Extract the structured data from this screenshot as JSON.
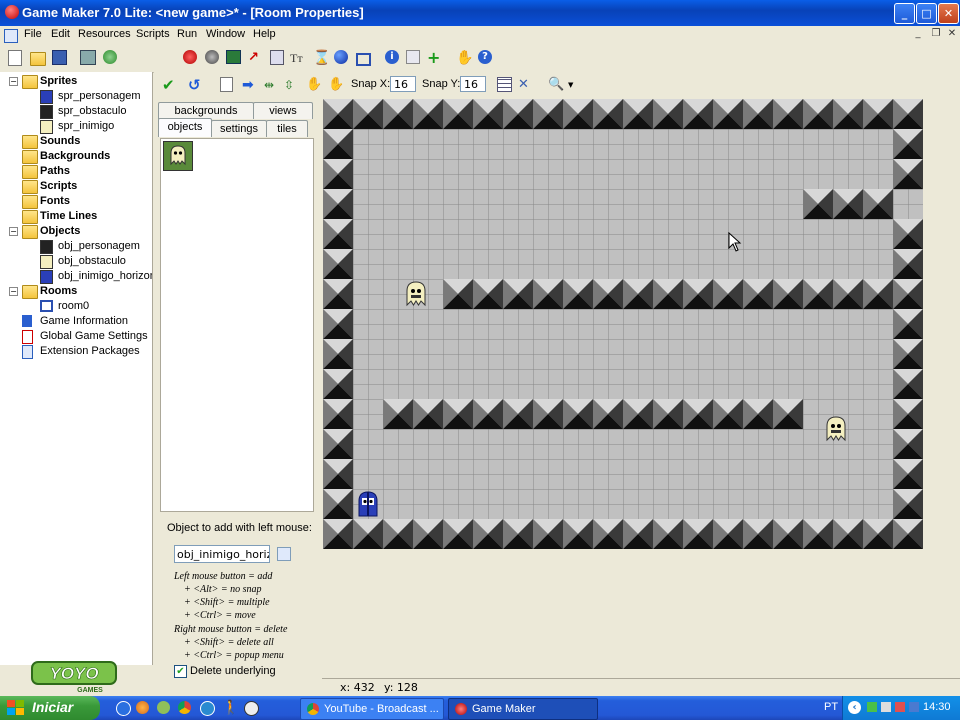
{
  "window": {
    "title": "Game Maker 7.0 Lite: <new game>* - [Room Properties]",
    "controls": [
      "minimize",
      "maximize",
      "close"
    ]
  },
  "menu": [
    "File",
    "Edit",
    "Resources",
    "Scripts",
    "Run",
    "Window",
    "Help"
  ],
  "tree": [
    {
      "label": "Sprites",
      "kind": "folder",
      "bold": true
    },
    {
      "label": "spr_personagem",
      "kind": "sprite",
      "bold": false
    },
    {
      "label": "spr_obstaculo",
      "kind": "sprite",
      "bold": false
    },
    {
      "label": "spr_inimigo",
      "kind": "sprite",
      "bold": false
    },
    {
      "label": "Sounds",
      "kind": "folder",
      "bold": true
    },
    {
      "label": "Backgrounds",
      "kind": "folder",
      "bold": true
    },
    {
      "label": "Paths",
      "kind": "folder",
      "bold": true
    },
    {
      "label": "Scripts",
      "kind": "folder",
      "bold": true
    },
    {
      "label": "Fonts",
      "kind": "folder",
      "bold": true
    },
    {
      "label": "Time Lines",
      "kind": "folder",
      "bold": true
    },
    {
      "label": "Objects",
      "kind": "folder",
      "bold": true
    },
    {
      "label": "obj_personagem",
      "kind": "object",
      "bold": false
    },
    {
      "label": "obj_obstaculo",
      "kind": "object",
      "bold": false
    },
    {
      "label": "obj_inimigo_horizont",
      "kind": "object",
      "bold": false
    },
    {
      "label": "Rooms",
      "kind": "folder",
      "bold": true
    },
    {
      "label": "room0",
      "kind": "room",
      "bold": false
    },
    {
      "label": "Game Information",
      "kind": "info",
      "bold": false
    },
    {
      "label": "Global Game Settings",
      "kind": "settings",
      "bold": false
    },
    {
      "label": "Extension Packages",
      "kind": "ext",
      "bold": false
    }
  ],
  "room_toolbar": {
    "snap_x_label": "Snap X:",
    "snap_x_value": "16",
    "snap_y_label": "Snap Y:",
    "snap_y_value": "16"
  },
  "tabs": {
    "backgrounds": "backgrounds",
    "views": "views",
    "objects": "objects",
    "settings": "settings",
    "tiles": "tiles"
  },
  "object_panel": {
    "add_label": "Object to add with left mouse:",
    "selected_object": "obj_inimigo_horizontal",
    "help_lines": [
      "Left mouse button = add",
      "+ <Alt> = no snap",
      "+ <Shift> = multiple",
      "+ <Ctrl> = move",
      "Right mouse button = delete",
      "+ <Shift> = delete all",
      "+ <Ctrl> = popup menu"
    ],
    "delete_underlying_label": "Delete underlying",
    "delete_underlying_checked": true
  },
  "status": {
    "x": "x: 432",
    "y": "y: 128"
  },
  "logo": {
    "text": "YOYO",
    "sub": "GAMES"
  },
  "taskbar": {
    "start_label": "Iniciar",
    "tasks": [
      "YouTube - Broadcast ...",
      "Game Maker"
    ],
    "lang": "PT",
    "clock": "14:30"
  },
  "colors": {
    "title_blue": "#0842b8",
    "taskbar_blue": "#245edb",
    "start_green": "#3a9a3a",
    "room_floor": "#c0c0c0",
    "wall_dark": "#202020"
  },
  "room": {
    "grid_cols": 20,
    "grid_rows": 15,
    "walls": [
      "WWWWWWWWWWWWWWWWWWWW",
      "W..................W",
      "W..................W",
      "W...............WWW W",
      "W..................W",
      "W..................W",
      "W...WWWWWWWWWWWWWWWW",
      "W..................W",
      "W..................W",
      "W..................W",
      "W.WWWWWWWWWWWWWW...W",
      "W..................W",
      "W..................W",
      "W..................W",
      "WWWWWWWWWWWWWWWWWWWW"
    ],
    "instances": [
      {
        "object": "obj_inimigo_horizontal",
        "col": 2.6,
        "row": 6.0
      },
      {
        "object": "obj_inimigo_horizontal",
        "col": 16.6,
        "row": 10.5
      },
      {
        "object": "obj_personagem",
        "col": 1.0,
        "row": 13.0
      }
    ]
  }
}
